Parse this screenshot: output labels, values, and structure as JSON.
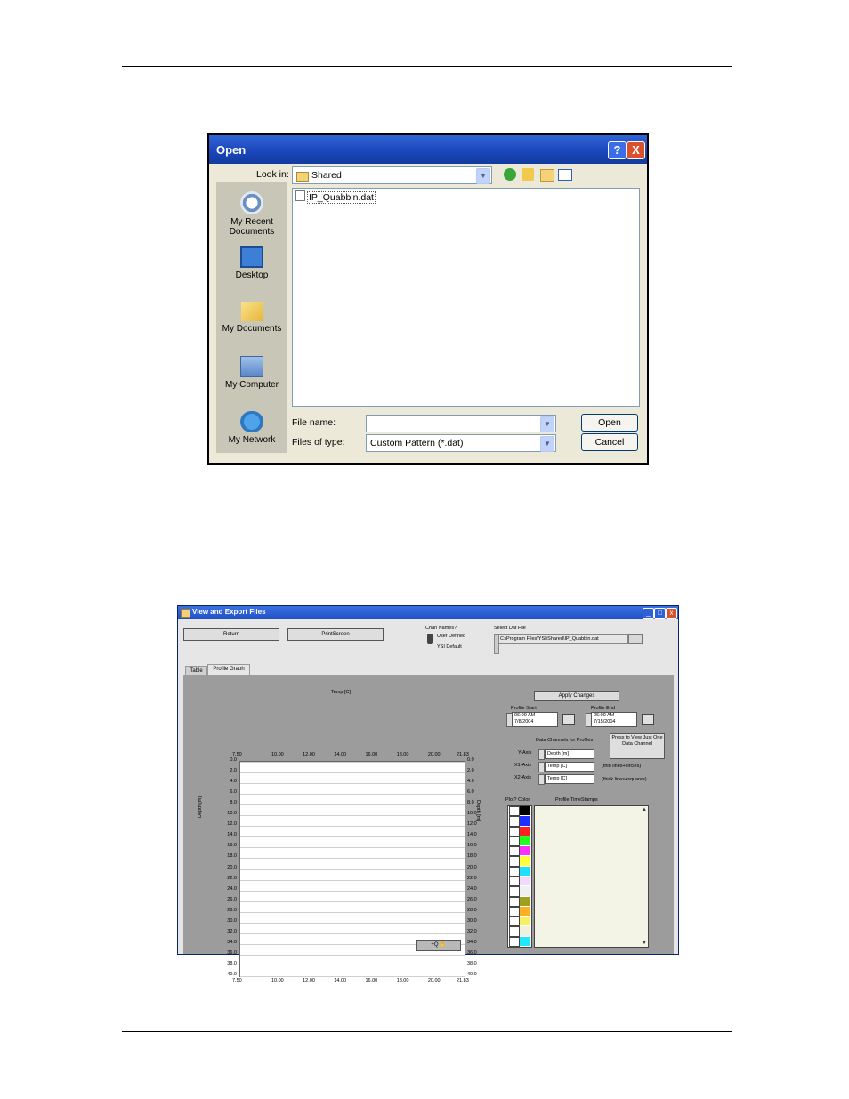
{
  "open_dialog": {
    "title": "Open",
    "help_glyph": "?",
    "close_glyph": "X",
    "look_in_label": "Look in:",
    "look_in_value": "Shared",
    "places": [
      {
        "label": "My Recent Documents",
        "icon": "recent-documents-icon"
      },
      {
        "label": "Desktop",
        "icon": "desktop-icon"
      },
      {
        "label": "My Documents",
        "icon": "my-documents-icon"
      },
      {
        "label": "My Computer",
        "icon": "my-computer-icon"
      },
      {
        "label": "My Network",
        "icon": "my-network-icon"
      }
    ],
    "files": [
      "IP_Quabbin.dat"
    ],
    "file_name_label": "File name:",
    "file_name_value": "",
    "file_type_label": "Files of type:",
    "file_type_value": "Custom Pattern (*.dat)",
    "open_button": "Open",
    "cancel_button": "Cancel"
  },
  "view_export": {
    "title": "View and Export Files",
    "return_button": "Return",
    "printscreen_button": "PrintScreen",
    "chan_names_label": "Chan Names?",
    "user_defined": "User Defined",
    "ysi_default": "YSI Default",
    "select_dat_label": "Select Dat File",
    "dat_path": "C:\\Program Files\\YSI\\Shared\\IP_Quabbin.dat",
    "tabs": [
      "Table",
      "Profile Graph"
    ],
    "apply_changes": "Apply Changes",
    "profile_start_label": "Profile Start",
    "profile_start_time": "06:00 AM",
    "profile_start_date": "7/8/2004",
    "profile_end_label": "Profile End",
    "profile_end_time": "06:00 AM",
    "profile_end_date": "7/15/2004",
    "data_channels_label": "Data Channels for Profiles",
    "press_to_view": "Press to View Just One Data Channel",
    "y_axis_label": "Y-Axis",
    "y_axis_value": "Depth [m]",
    "x1_axis_label": "X1-Axis",
    "x1_axis_value": "Temp [C]",
    "x1_note": "(thin lines+circles)",
    "x2_axis_label": "X2-Axis",
    "x2_axis_value": "Temp [C]",
    "x2_note": "(thick lines+squares)",
    "plot_color_label": "Plot? Color",
    "timestamps_label": "Profile TimeStamps",
    "zoom_button": "+Q ✋",
    "swatches": [
      "#000000",
      "#1f2fff",
      "#ff2020",
      "#20ff20",
      "#ff30ff",
      "#ffff40",
      "#20e0ff",
      "#f0d8ff",
      "#f0f0f0",
      "#a0a020",
      "#ffb020",
      "#f8f060",
      "#f0f0e0",
      "#20e8ff"
    ]
  },
  "chart_data": {
    "type": "line",
    "title": "",
    "xlabel": "Temp [C]",
    "ylabel": "Depth [m]",
    "xlim": [
      7.5,
      21.83
    ],
    "ylim": [
      0,
      40
    ],
    "x_ticks": [
      "7.50",
      "10.00",
      "12.00",
      "14.00",
      "16.00",
      "18.00",
      "20.00",
      "21.83"
    ],
    "y_ticks": [
      "0.0",
      "2.0",
      "4.0",
      "6.0",
      "8.0",
      "10.0",
      "12.0",
      "14.0",
      "16.0",
      "18.0",
      "20.0",
      "22.0",
      "24.0",
      "26.0",
      "28.0",
      "30.0",
      "32.0",
      "34.0",
      "36.0",
      "38.0",
      "40.0"
    ],
    "grid": true,
    "series": []
  }
}
